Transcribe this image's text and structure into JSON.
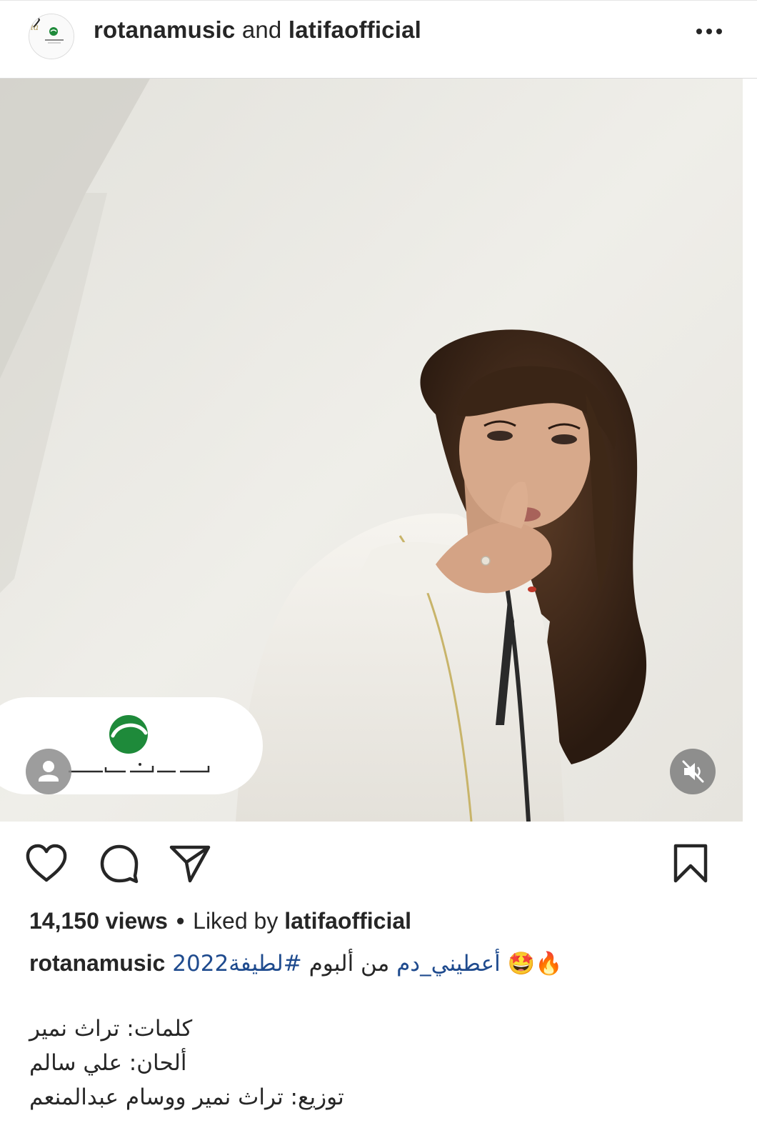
{
  "header": {
    "username_1": "rotanamusic",
    "connector": "and",
    "username_2": "latifaofficial",
    "more_icon": "more-horizontal-icon"
  },
  "media": {
    "type": "video",
    "watermark_logo": "rotana-logo",
    "tag_icon": "user-tag-icon",
    "audio_icon": "muted-speaker-icon"
  },
  "actions": {
    "icons": [
      "heart-icon",
      "comment-icon",
      "send-icon",
      "bookmark-icon"
    ]
  },
  "stats": {
    "views": "14,150 views",
    "separator": "•",
    "liked_prefix": "Liked by",
    "liked_user": "latifaofficial"
  },
  "caption": {
    "username": "rotanamusic",
    "emojis": "🔥🤩",
    "song_hashtag": "أعطيني_دم",
    "from_album": "من ألبوم",
    "album_hashtag": "#لطيفة2022",
    "lines": [
      "كلمات: تراث نمير",
      "ألحان: علي سالم",
      "توزيع: تراث نمير ووسام عبدالمنعم"
    ]
  },
  "colors": {
    "text": "#262626",
    "hashtag": "#1f4b8e",
    "divider": "#dbdbdb",
    "rotana_green": "#1e8a3a"
  }
}
